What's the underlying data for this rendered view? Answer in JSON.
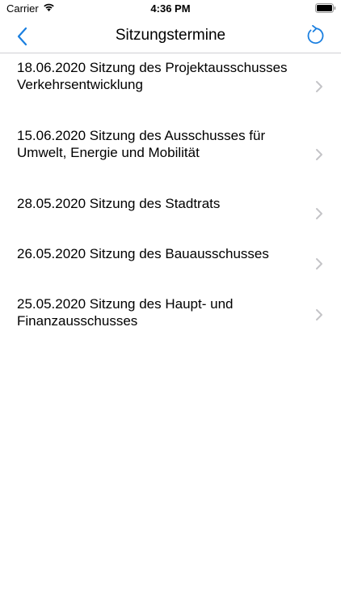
{
  "status_bar": {
    "carrier": "Carrier",
    "time": "4:36 PM",
    "icons": [
      "wifi-icon",
      "battery-icon"
    ]
  },
  "nav": {
    "title": "Sitzungstermine",
    "back_icon": "chevron-left-icon",
    "refresh_icon": "refresh-icon",
    "accent_color": "#1a7fe0"
  },
  "meetings": [
    {
      "label": "18.06.2020 Sitzung des Projektausschusses Verkehrsentwicklung"
    },
    {
      "label": "15.06.2020 Sitzung des Ausschusses für Umwelt, Energie und Mobilität"
    },
    {
      "label": "28.05.2020 Sitzung des Stadtrats"
    },
    {
      "label": "26.05.2020 Sitzung des Bauausschusses"
    },
    {
      "label": "25.05.2020 Sitzung des Haupt- und Finanzausschusses"
    }
  ]
}
